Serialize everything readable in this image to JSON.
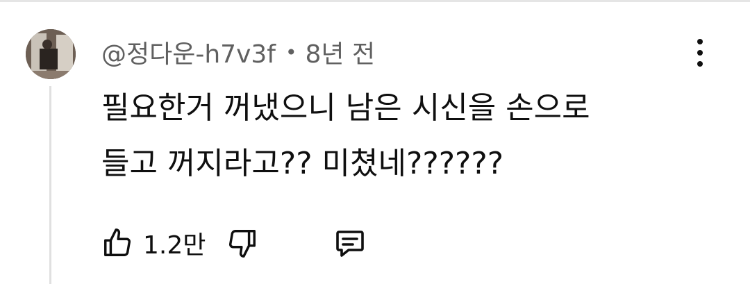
{
  "comment": {
    "author": "@정다운-h7v3f",
    "separator": "•",
    "time": "8년 전",
    "text_line_1": "필요한거 꺼냈으니 남은 시신을 손으로",
    "text_line_2": "들고 꺼지라고?? 미쳤네??????",
    "like_count": "1.2만"
  },
  "icons": {
    "avatar": "avatar-photo",
    "menu": "more-vert-icon",
    "like": "thumb-up-icon",
    "dislike": "thumb-down-icon",
    "reply": "reply-comment-icon"
  }
}
